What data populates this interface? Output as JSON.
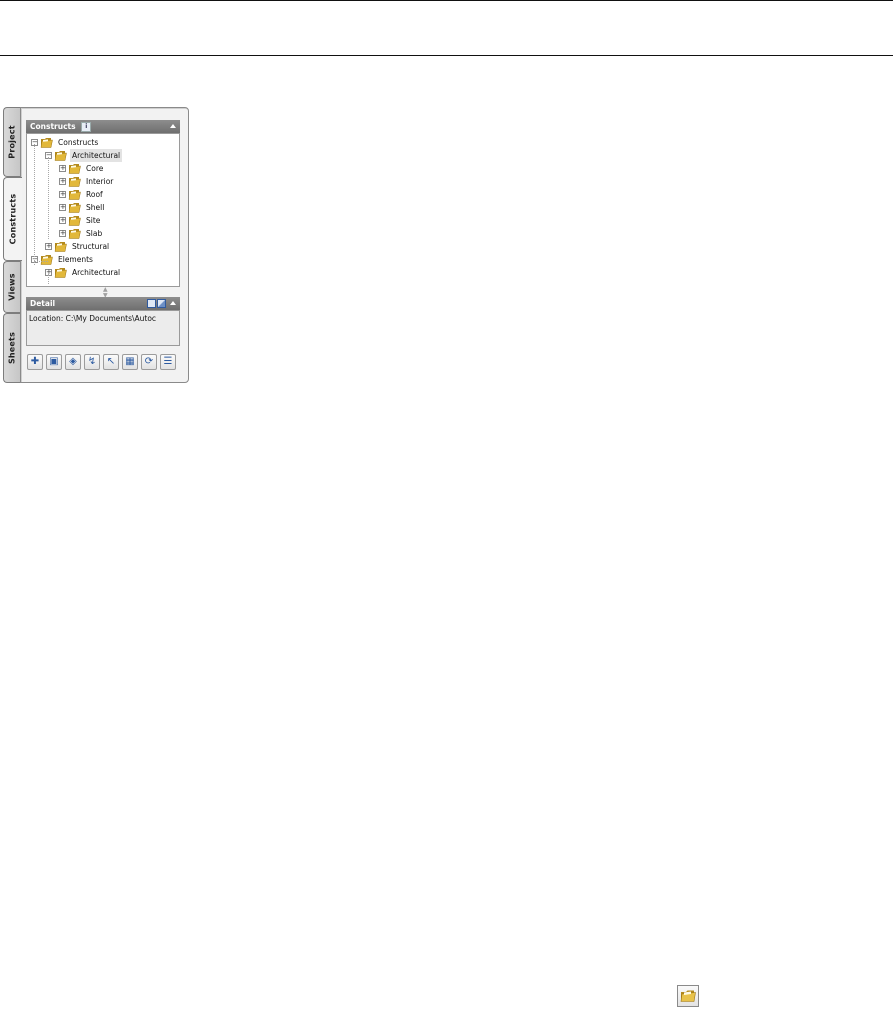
{
  "tabs": [
    {
      "label": "Project"
    },
    {
      "label": "Constructs"
    },
    {
      "label": "Views"
    },
    {
      "label": "Sheets"
    }
  ],
  "constructs_panel": {
    "title": "Constructs",
    "badge": "i"
  },
  "tree": [
    {
      "label": "Constructs",
      "depth": 0,
      "toggle": "−"
    },
    {
      "label": "Architectural",
      "depth": 1,
      "toggle": "−"
    },
    {
      "label": "Core",
      "depth": 2,
      "toggle": "+"
    },
    {
      "label": "Interior",
      "depth": 2,
      "toggle": "+"
    },
    {
      "label": "Roof",
      "depth": 2,
      "toggle": "+"
    },
    {
      "label": "Shell",
      "depth": 2,
      "toggle": "+"
    },
    {
      "label": "Site",
      "depth": 2,
      "toggle": "+"
    },
    {
      "label": "Slab",
      "depth": 2,
      "toggle": "+"
    },
    {
      "label": "Structural",
      "depth": 1,
      "toggle": "+"
    },
    {
      "label": "Elements",
      "depth": 0,
      "toggle": "−"
    },
    {
      "label": "Architectural",
      "depth": 1,
      "toggle": "+"
    }
  ],
  "detail_panel": {
    "title": "Detail",
    "location": "Location: C:\\My Documents\\Autoc"
  },
  "toolbar_icons": [
    "add-construct-icon",
    "add-element-icon",
    "add-category-icon",
    "repath-icon",
    "select-icon",
    "bulk-edit-icon",
    "refresh-icon",
    "properties-icon"
  ],
  "colors": {
    "folder": "#e2b83a",
    "folder_dark": "#b48a1c",
    "accent": "#2f5a9e"
  }
}
